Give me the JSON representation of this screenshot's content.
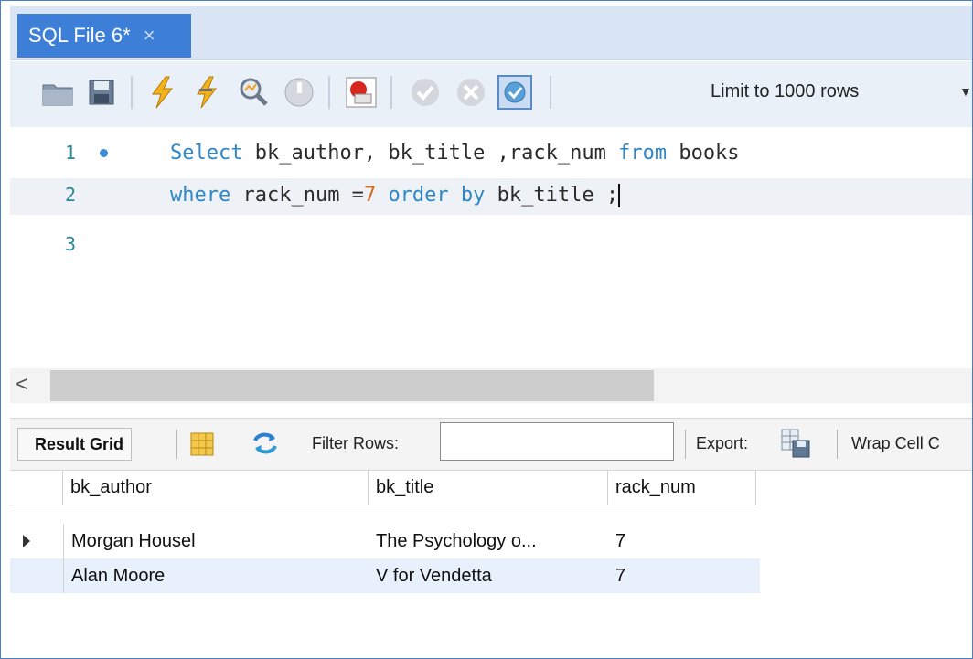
{
  "tab": {
    "title": "SQL File 6*",
    "close": "×"
  },
  "toolbar": {
    "icons": [
      "open-folder-icon",
      "save-icon",
      "execute-icon",
      "execute-current-icon",
      "explain-icon",
      "stop-icon",
      "toggle-errors-icon",
      "commit-icon",
      "rollback-icon",
      "autocommit-icon"
    ],
    "limit_label": "Limit to 1000 rows",
    "limit_caret": "▼"
  },
  "editor": {
    "lines": [
      {
        "num": "1",
        "parts": [
          {
            "t": "Select",
            "c": "kw"
          },
          {
            "t": " bk_author, bk_title ,rack_num ",
            "c": ""
          },
          {
            "t": "from",
            "c": "kw"
          },
          {
            "t": " books",
            "c": ""
          }
        ]
      },
      {
        "num": "2",
        "parts": [
          {
            "t": "where",
            "c": "kw"
          },
          {
            "t": " rack_num =",
            "c": ""
          },
          {
            "t": "7",
            "c": "num"
          },
          {
            "t": " ",
            "c": ""
          },
          {
            "t": "order by",
            "c": "kw"
          },
          {
            "t": " bk_title ;",
            "c": ""
          }
        ]
      },
      {
        "num": "3",
        "parts": []
      }
    ]
  },
  "scroll": {
    "left_arrow": "<"
  },
  "results": {
    "tab_label": "Result Grid",
    "filter_label": "Filter Rows:",
    "filter_value": "",
    "export_label": "Export:",
    "wrap_label": "Wrap Cell C",
    "columns": [
      "bk_author",
      "bk_title",
      "rack_num"
    ],
    "rows": [
      [
        "Morgan Housel",
        "The Psychology o...",
        "7"
      ],
      [
        "Alan Moore",
        "V for Vendetta",
        "7"
      ]
    ]
  },
  "colors": {
    "accent": "#3d7ed6",
    "keyword": "#2f87c6",
    "number": "#d2691e",
    "line_numbers": "#2d8a98"
  }
}
